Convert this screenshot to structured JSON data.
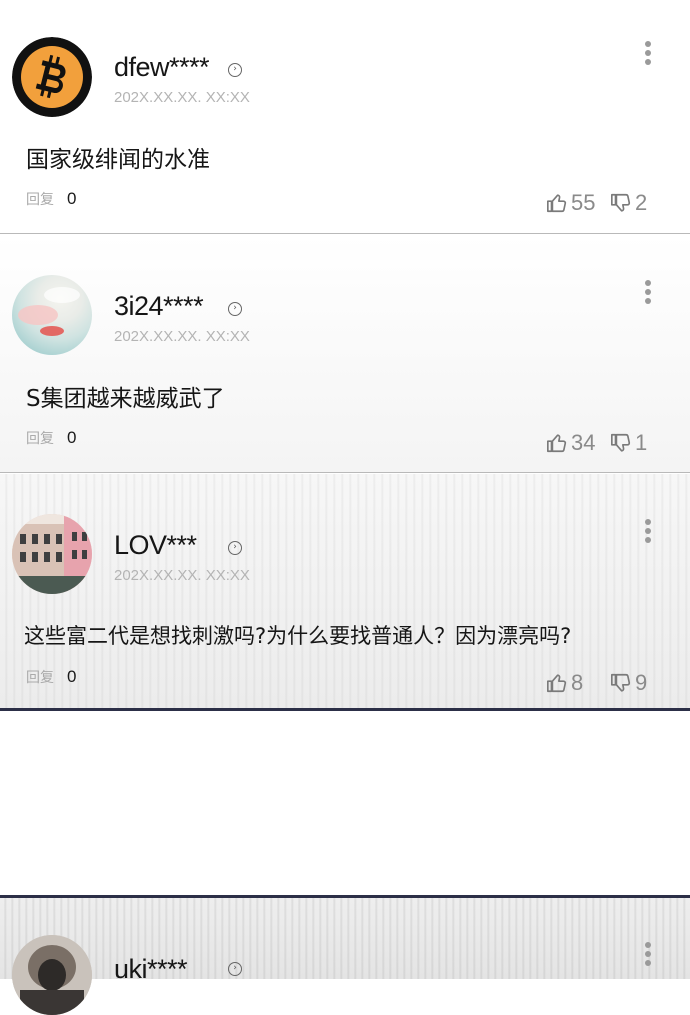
{
  "comments": [
    {
      "username": "dfew****",
      "timestamp": "202X.XX.XX. XX:XX",
      "text": "国家级绯闻的水准",
      "reply_label": "回复",
      "reply_count": "0",
      "likes": "55",
      "dislikes": "2",
      "avatar": "bitcoin-logo"
    },
    {
      "username": "3i24****",
      "timestamp": "202X.XX.XX. XX:XX",
      "text": "S集团越来越威武了",
      "reply_label": "回复",
      "reply_count": "0",
      "likes": "34",
      "dislikes": "1",
      "avatar": "pastel-abstract-photo"
    },
    {
      "username": "LOV***",
      "timestamp": "202X.XX.XX. XX:XX",
      "text": "这些富二代是想找刺激吗?为什么要找普通人？因为漂亮吗?",
      "reply_label": "回复",
      "reply_count": "0",
      "likes": "8",
      "dislikes": "9",
      "avatar": "pink-building-photo"
    },
    {
      "username": "uki****",
      "avatar": "hooded-person-photo"
    }
  ],
  "icons": {
    "chevron": "chevron-right-icon",
    "more": "more-vertical-icon",
    "like": "thumbs-up-icon",
    "dislike": "thumbs-down-icon"
  },
  "colors": {
    "divider": "#b9b9b9",
    "panel_border": "#2c2f47",
    "bitcoin_orange": "#f2a03c"
  }
}
